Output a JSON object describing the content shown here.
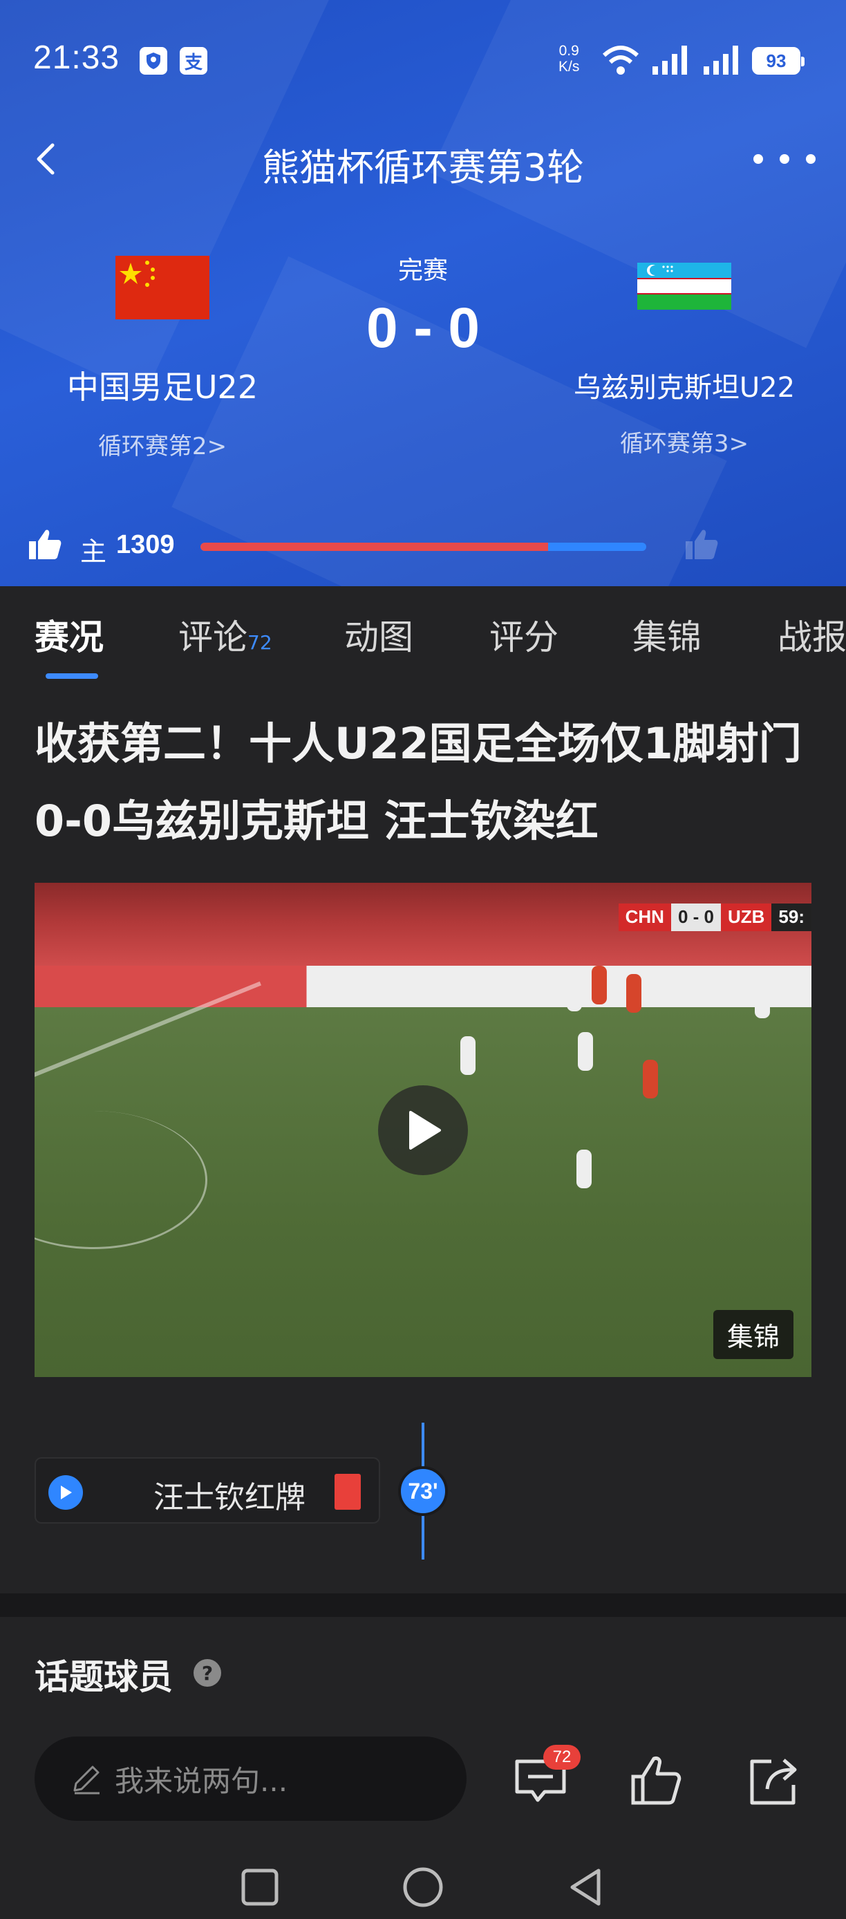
{
  "status_bar": {
    "time": "21:33",
    "badges": [
      "shield-icon",
      "支"
    ],
    "net_speed_value": "0.9",
    "net_speed_unit": "K/s",
    "battery": "93"
  },
  "nav": {
    "title": "熊猫杯循环赛第3轮"
  },
  "match": {
    "status": "完赛",
    "score": "0 - 0",
    "home": {
      "name": "中国男足U22",
      "sub": "循环赛第2>"
    },
    "away": {
      "name": "乌兹别克斯坦U22",
      "sub": "循环赛第3>"
    }
  },
  "likes": {
    "home_label": "主",
    "home_count": "1309",
    "home_share": 0.78
  },
  "tabs": [
    {
      "label": "赛况"
    },
    {
      "label": "评论",
      "badge": "72"
    },
    {
      "label": "动图"
    },
    {
      "label": "评分"
    },
    {
      "label": "集锦"
    },
    {
      "label": "战报"
    }
  ],
  "headline": "收获第二！十人U22国足全场仅1脚射门0-0乌兹别克斯坦 汪士钦染红",
  "video": {
    "scoreboard": {
      "home": "CHN",
      "score": "0 - 0",
      "away": "UZB",
      "time": "59:"
    },
    "tag": "集锦"
  },
  "event": {
    "text": "汪士钦红牌",
    "minute": "73'"
  },
  "topic": {
    "title": "话题球员",
    "help": "?"
  },
  "bottom_bar": {
    "placeholder": "我来说两句...",
    "comment_badge": "72"
  },
  "colors": {
    "header_blue": "#2a5fd8",
    "accent_blue": "#3d8bff",
    "home_red": "#e84a4a",
    "background": "#232325"
  }
}
